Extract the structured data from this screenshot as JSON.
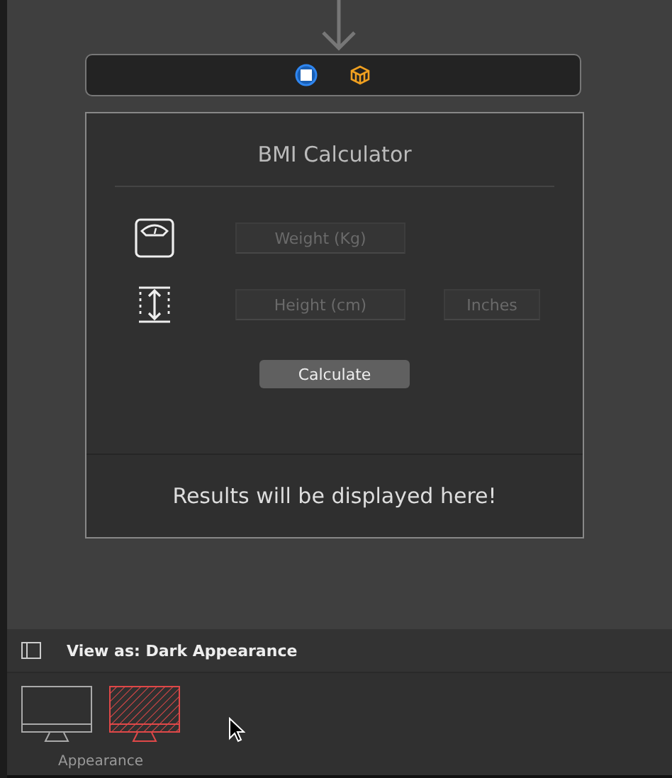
{
  "scene_dock": {
    "icons": [
      {
        "kind": "view-controller"
      },
      {
        "kind": "cube"
      }
    ]
  },
  "view_controller": {
    "title": "BMI Calculator",
    "rows": [
      {
        "kind": "weight",
        "fields": [
          {
            "placeholder": "Weight (Kg)"
          }
        ]
      },
      {
        "kind": "height",
        "fields": [
          {
            "placeholder": "Height (cm)"
          },
          {
            "placeholder": "Inches"
          }
        ]
      }
    ],
    "button": "Calculate",
    "result": "Results will be displayed here!"
  },
  "bottom_bar": {
    "label": "View as: Dark Appearance"
  },
  "appearance": {
    "label": "Appearance",
    "options": [
      {
        "kind": "light",
        "selected": false
      },
      {
        "kind": "dark",
        "selected": true
      }
    ]
  }
}
